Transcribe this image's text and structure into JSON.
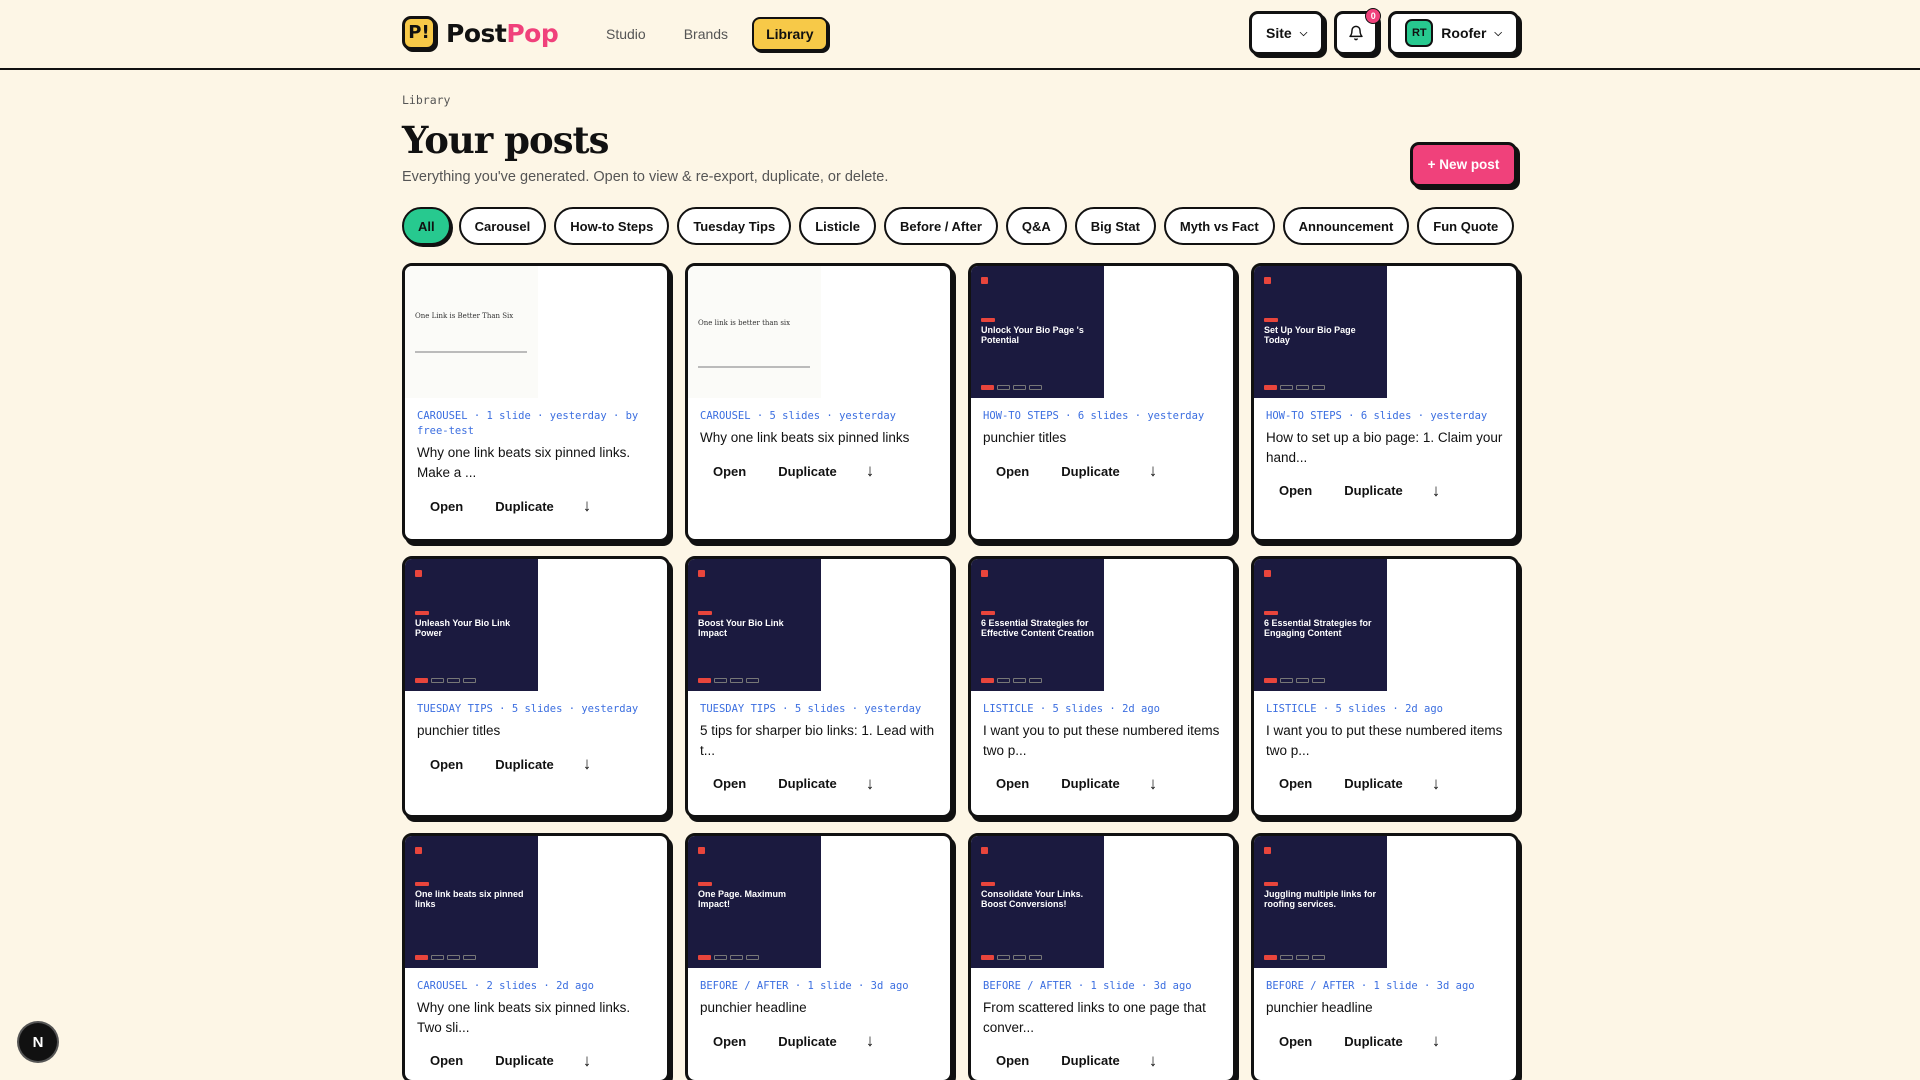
{
  "brand": {
    "mark": "P!",
    "name_a": "Post",
    "name_b": "Pop"
  },
  "nav": [
    "Studio",
    "Brands",
    "Library"
  ],
  "top": {
    "site": "Site",
    "notifications": "0",
    "avatar": "RT",
    "user": "Roofer"
  },
  "breadcrumb": "Library",
  "title": "Your posts",
  "subtitle": "Everything you've generated. Open to view & re-export, duplicate, or delete.",
  "new_post": "+ New post",
  "filters": [
    "All",
    "Carousel",
    "How-to Steps",
    "Tuesday Tips",
    "Listicle",
    "Before / After",
    "Q&A",
    "Big Stat",
    "Myth vs Fact",
    "Announcement",
    "Fun Quote"
  ],
  "actions": {
    "open": "Open",
    "duplicate": "Duplicate",
    "download": "↓"
  },
  "cards": [
    {
      "meta": "CAROUSEL · 1 slide · yesterday · by free-test",
      "title": "Why one link beats six pinned links. Make a ...",
      "thumb": "light",
      "headline": "One Link is Better Than Six"
    },
    {
      "meta": "CAROUSEL · 5 slides · yesterday",
      "title": "Why one link beats six pinned links",
      "thumb": "light",
      "headline": "One link is better than six"
    },
    {
      "meta": "HOW-TO STEPS · 6 slides · yesterday",
      "title": "punchier titles",
      "thumb": "dark",
      "headline": "Unlock Your Bio Page 's Potential"
    },
    {
      "meta": "HOW-TO STEPS · 6 slides · yesterday",
      "title": "How to set up a bio page: 1. Claim your hand...",
      "thumb": "dark",
      "headline": "Set Up Your Bio Page Today"
    },
    {
      "meta": "TUESDAY TIPS · 5 slides · yesterday",
      "title": "punchier titles",
      "thumb": "dark",
      "headline": "Unleash Your Bio Link Power"
    },
    {
      "meta": "TUESDAY TIPS · 5 slides · yesterday",
      "title": "5 tips for sharper bio links: 1. Lead with t...",
      "thumb": "dark",
      "headline": "Boost Your Bio Link Impact"
    },
    {
      "meta": "LISTICLE · 5 slides · 2d ago",
      "title": "I want you to put these numbered items two p...",
      "thumb": "dark",
      "headline": "6 Essential Strategies for Effective Content Creation"
    },
    {
      "meta": "LISTICLE · 5 slides · 2d ago",
      "title": "I want you to put these numbered items two p...",
      "thumb": "dark",
      "headline": "6 Essential Strategies for Engaging Content"
    },
    {
      "meta": "CAROUSEL · 2 slides · 2d ago",
      "title": "Why one link beats six pinned links. Two sli...",
      "thumb": "dark",
      "headline": "One link beats six pinned links"
    },
    {
      "meta": "BEFORE / AFTER · 1 slide · 3d ago",
      "title": "punchier headline",
      "thumb": "dark",
      "headline": "One Page. Maximum Impact!"
    },
    {
      "meta": "BEFORE / AFTER · 1 slide · 3d ago",
      "title": "From scattered links to one page that conver...",
      "thumb": "dark",
      "headline": "Consolidate Your Links. Boost Conversions!"
    },
    {
      "meta": "BEFORE / AFTER · 1 slide · 3d ago",
      "title": "punchier headline",
      "thumb": "dark",
      "headline": "Juggling multiple links for roofing services."
    }
  ],
  "corner_badge": "N",
  "colors": {
    "bg": "#fdf6e6",
    "accent_yellow": "#f7c948",
    "accent_pink": "#f0417b",
    "accent_green": "#27c98f",
    "meta_blue": "#3b6ee0",
    "thumb_dark": "#1b1a3f"
  }
}
